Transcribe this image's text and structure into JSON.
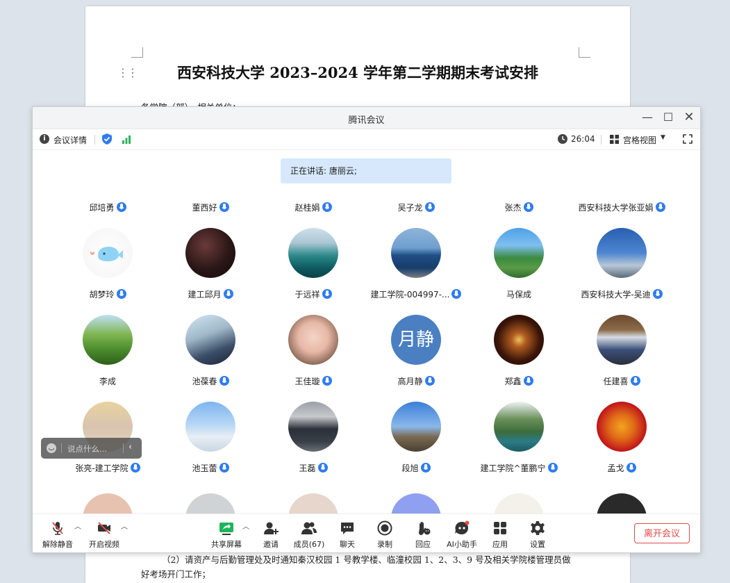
{
  "document": {
    "title": "西安科技大学 2023–2024 学年第二学期期末考试安排",
    "line_top": "各学院（部）、相关单位：",
    "line_bottom": "（2）请资产与后勤管理处及时通知秦汉校园 1 号教学楼、临潼校园 1、2、3、9 号及相关学院楼管理员做",
    "line_bottom2": "好考场开门工作；"
  },
  "window": {
    "title": "腾讯会议"
  },
  "infobar": {
    "meeting_info": "会议详情",
    "timer": "26:04",
    "view_mode": "宫格视图"
  },
  "speaker": "正在讲话: 唐丽云;",
  "participants": [
    {
      "name": "邱培勇",
      "mic": true
    },
    {
      "name": "董西好",
      "mic": true
    },
    {
      "name": "赵桂娟",
      "mic": true
    },
    {
      "name": "吴子龙",
      "mic": true
    },
    {
      "name": "张杰",
      "mic": true
    },
    {
      "name": "西安科技大学张亚娟",
      "mic": true
    },
    {
      "name": "胡梦玲",
      "mic": true
    },
    {
      "name": "建工邱月",
      "mic": true
    },
    {
      "name": "于远祥",
      "mic": true
    },
    {
      "name": "建工学院-004997-...",
      "mic": true
    },
    {
      "name": "马保成",
      "mic": false
    },
    {
      "name": "西安科技大学-吴迪",
      "mic": true
    },
    {
      "name": "李成",
      "mic": false
    },
    {
      "name": "池葆春",
      "mic": true
    },
    {
      "name": "王佳璇",
      "mic": true
    },
    {
      "name": "高月静",
      "mic": true,
      "avatar_text": "月静"
    },
    {
      "name": "郑鑫",
      "mic": true
    },
    {
      "name": "任建喜",
      "mic": true
    },
    {
      "name": "张亮-建工学院",
      "mic": true
    },
    {
      "name": "池玉蕾",
      "mic": true
    },
    {
      "name": "王磊",
      "mic": true
    },
    {
      "name": "段旭",
      "mic": true
    },
    {
      "name": "建工学院^董鹏宁",
      "mic": true
    },
    {
      "name": "孟戈",
      "mic": true
    }
  ],
  "chat": {
    "placeholder": "说点什么..."
  },
  "toolbar": {
    "unmute": "解除静音",
    "start_video": "开启视频",
    "share_screen": "共享屏幕",
    "invite": "邀请",
    "members": "成员(67)",
    "chat": "聊天",
    "record": "录制",
    "reactions": "回应",
    "ai_assistant": "AI小助手",
    "apps": "应用",
    "settings": "设置",
    "leave": "离开会议"
  },
  "colors": {
    "accent": "#2f7cf0",
    "leave": "#e04a4a",
    "banner": "#d7e8fc",
    "signal": "#2bb45a"
  }
}
